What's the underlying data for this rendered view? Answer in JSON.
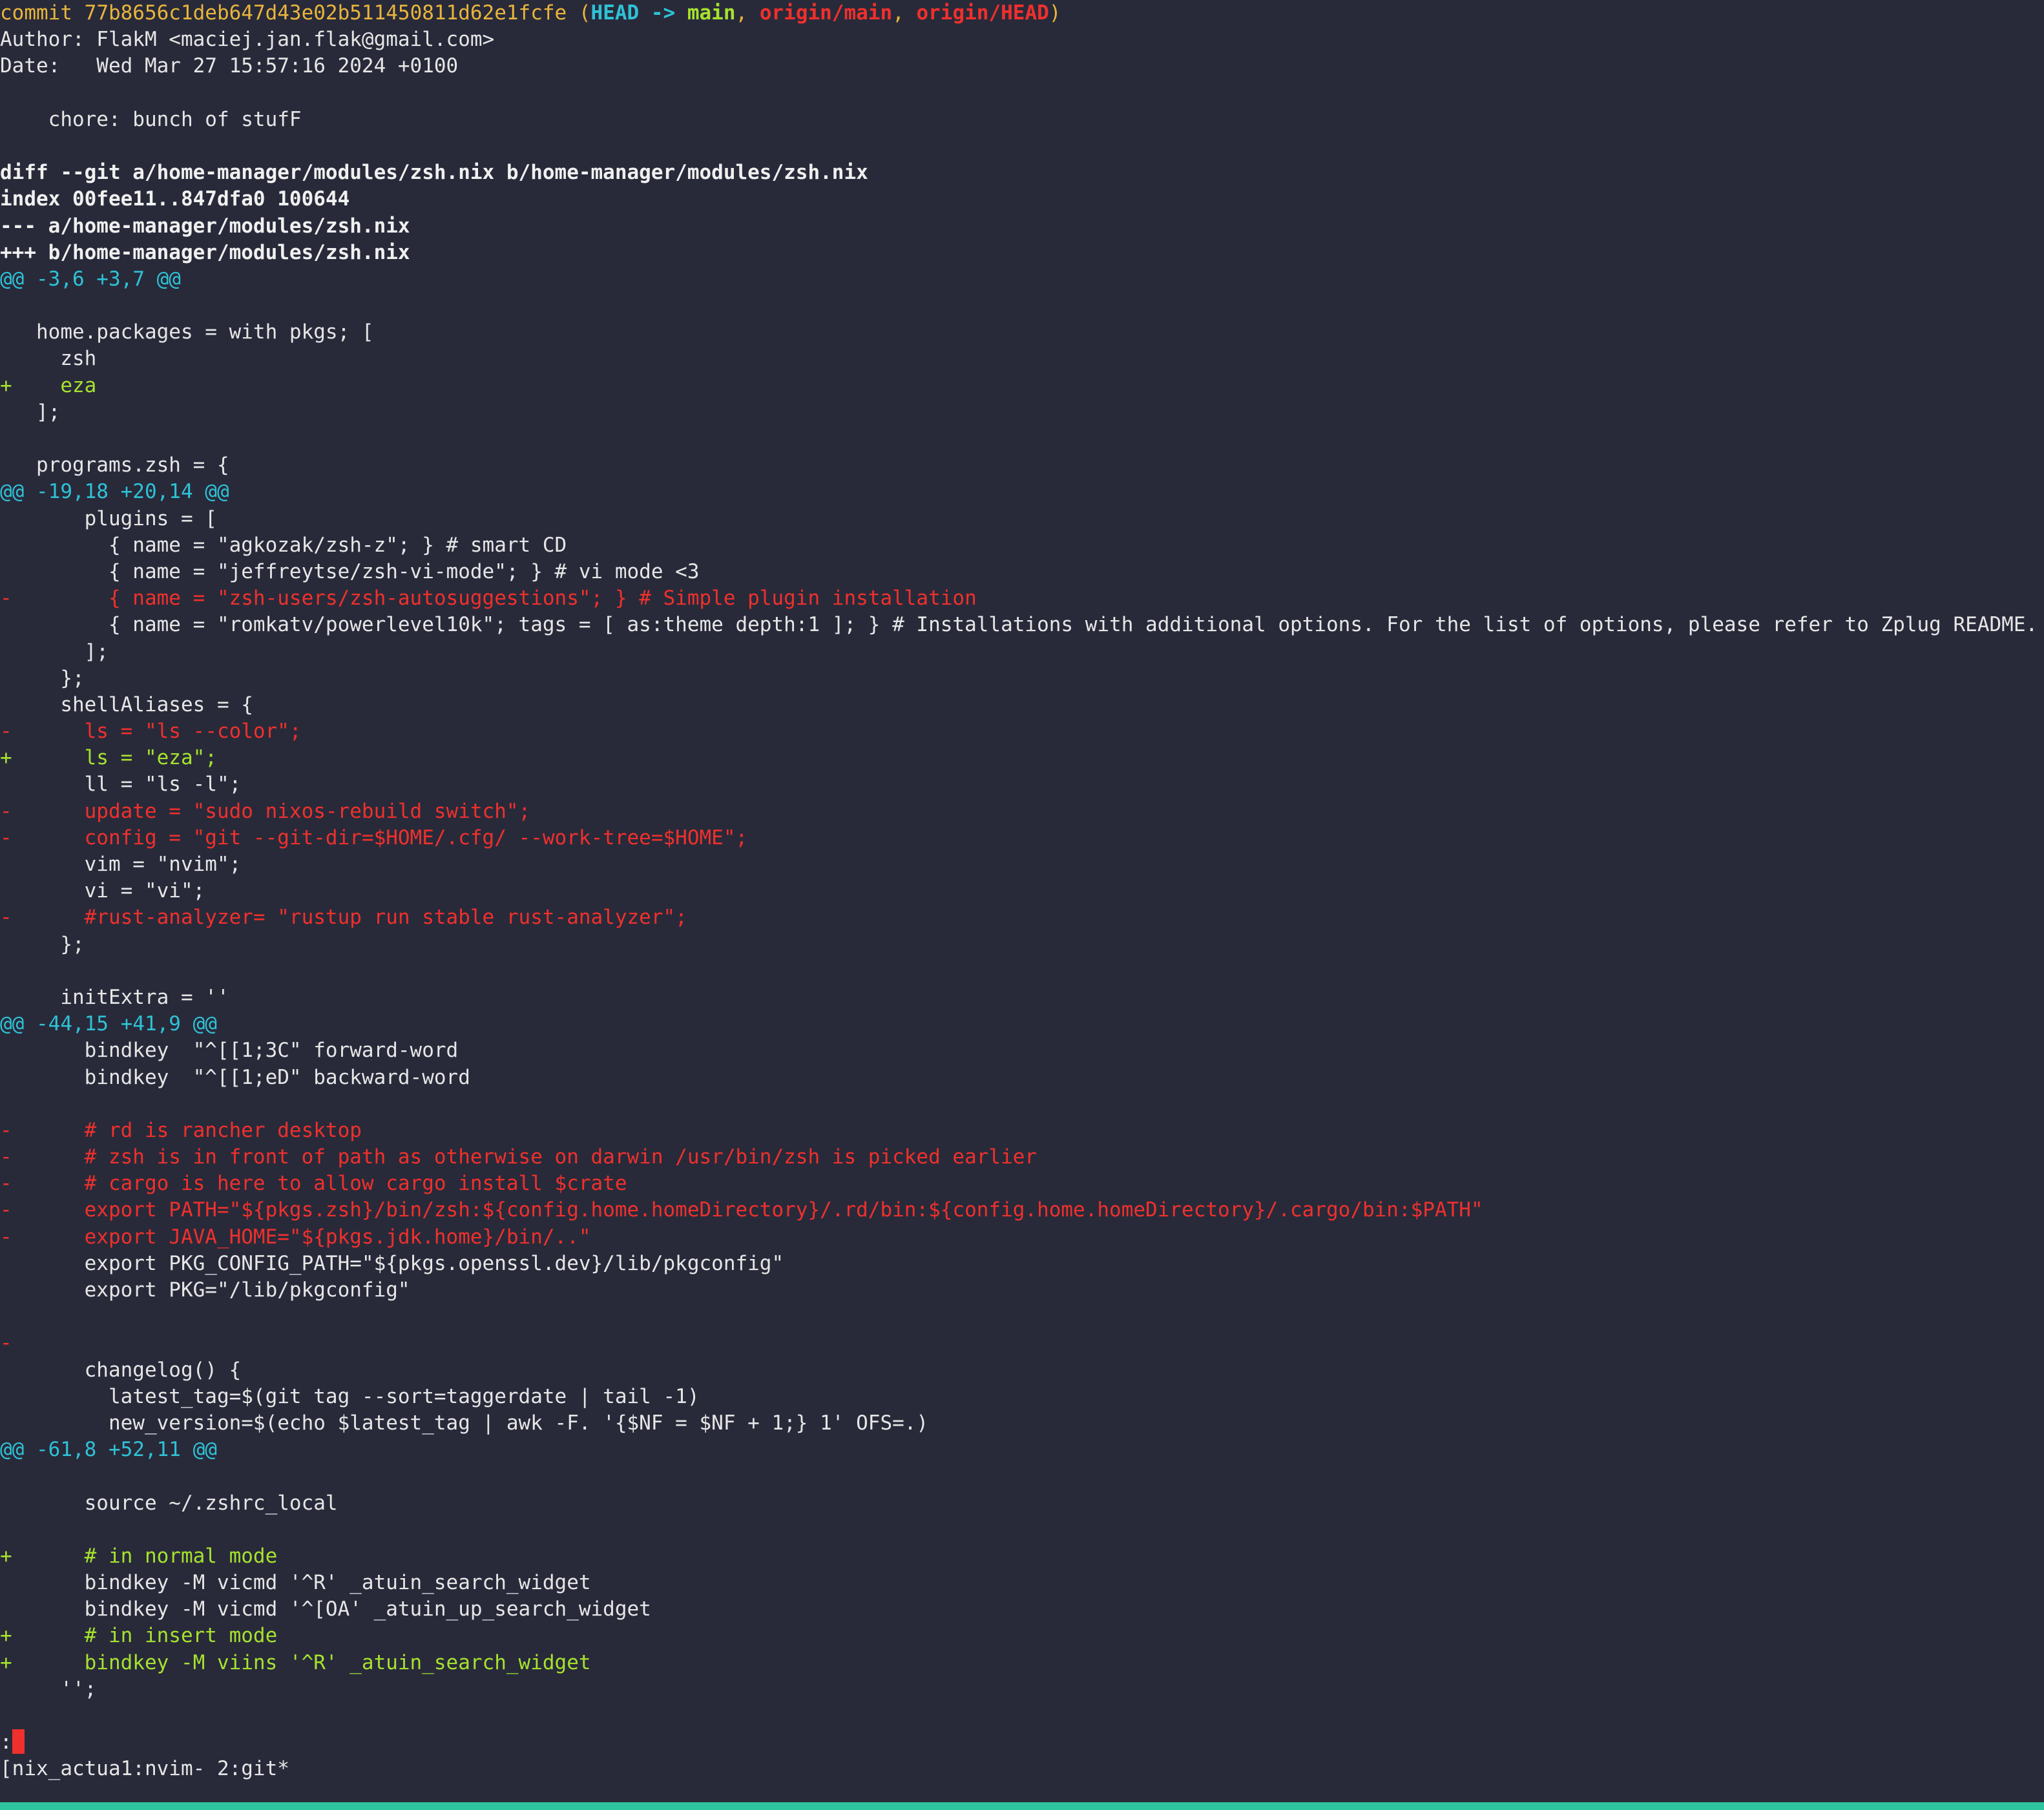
{
  "commit_header": {
    "prefix": "commit ",
    "hash": "77b8656c1deb647d43e02b511450811d62e1fcfe",
    "open": " (",
    "head": "HEAD -> ",
    "branch": "main",
    "sep1": ", ",
    "origin_main": "origin/main",
    "sep2": ", ",
    "origin_head": "origin/HEAD",
    "close": ")"
  },
  "lines": [
    {
      "type": "ctx",
      "text": "Author: FlakM <maciej.jan.flak@gmail.com>"
    },
    {
      "type": "ctx",
      "text": "Date:   Wed Mar 27 15:57:16 2024 +0100"
    },
    {
      "type": "ctx",
      "text": ""
    },
    {
      "type": "ctx",
      "text": "    chore: bunch of stufF"
    },
    {
      "type": "ctx",
      "text": ""
    },
    {
      "type": "meta",
      "text": "diff --git a/home-manager/modules/zsh.nix b/home-manager/modules/zsh.nix"
    },
    {
      "type": "meta",
      "text": "index 00fee11..847dfa0 100644"
    },
    {
      "type": "meta",
      "text": "--- a/home-manager/modules/zsh.nix"
    },
    {
      "type": "meta",
      "text": "+++ b/home-manager/modules/zsh.nix"
    },
    {
      "type": "hunk",
      "text": "@@ -3,6 +3,7 @@"
    },
    {
      "type": "ctx",
      "text": ""
    },
    {
      "type": "ctx",
      "text": "   home.packages = with pkgs; ["
    },
    {
      "type": "ctx",
      "text": "     zsh"
    },
    {
      "type": "add",
      "text": "+    eza"
    },
    {
      "type": "ctx",
      "text": "   ];"
    },
    {
      "type": "ctx",
      "text": ""
    },
    {
      "type": "ctx",
      "text": "   programs.zsh = {"
    },
    {
      "type": "hunk",
      "text": "@@ -19,18 +20,14 @@"
    },
    {
      "type": "ctx",
      "text": "       plugins = ["
    },
    {
      "type": "ctx",
      "text": "         { name = \"agkozak/zsh-z\"; } # smart CD"
    },
    {
      "type": "ctx",
      "text": "         { name = \"jeffreytse/zsh-vi-mode\"; } # vi mode <3"
    },
    {
      "type": "del",
      "text": "-        { name = \"zsh-users/zsh-autosuggestions\"; } # Simple plugin installation"
    },
    {
      "type": "ctx",
      "text": "         { name = \"romkatv/powerlevel10k\"; tags = [ as:theme depth:1 ]; } # Installations with additional options. For the list of options, please refer to Zplug README."
    },
    {
      "type": "ctx",
      "text": "       ];"
    },
    {
      "type": "ctx",
      "text": "     };"
    },
    {
      "type": "ctx",
      "text": "     shellAliases = {"
    },
    {
      "type": "del",
      "text": "-      ls = \"ls --color\";"
    },
    {
      "type": "add",
      "text": "+      ls = \"eza\";"
    },
    {
      "type": "ctx",
      "text": "       ll = \"ls -l\";"
    },
    {
      "type": "del",
      "text": "-      update = \"sudo nixos-rebuild switch\";"
    },
    {
      "type": "del",
      "text": "-      config = \"git --git-dir=$HOME/.cfg/ --work-tree=$HOME\";"
    },
    {
      "type": "ctx",
      "text": "       vim = \"nvim\";"
    },
    {
      "type": "ctx",
      "text": "       vi = \"vi\";"
    },
    {
      "type": "del",
      "text": "-      #rust-analyzer= \"rustup run stable rust-analyzer\";"
    },
    {
      "type": "ctx",
      "text": "     };"
    },
    {
      "type": "ctx",
      "text": ""
    },
    {
      "type": "ctx",
      "text": "     initExtra = ''"
    },
    {
      "type": "hunk",
      "text": "@@ -44,15 +41,9 @@"
    },
    {
      "type": "ctx",
      "text": "       bindkey  \"^[[1;3C\" forward-word"
    },
    {
      "type": "ctx",
      "text": "       bindkey  \"^[[1;eD\" backward-word"
    },
    {
      "type": "ctx",
      "text": ""
    },
    {
      "type": "del",
      "text": "-      # rd is rancher desktop"
    },
    {
      "type": "del",
      "text": "-      # zsh is in front of path as otherwise on darwin /usr/bin/zsh is picked earlier"
    },
    {
      "type": "del",
      "text": "-      # cargo is here to allow cargo install $crate"
    },
    {
      "type": "del",
      "text": "-      export PATH=\"${pkgs.zsh}/bin/zsh:${config.home.homeDirectory}/.rd/bin:${config.home.homeDirectory}/.cargo/bin:$PATH\""
    },
    {
      "type": "del",
      "text": "-      export JAVA_HOME=\"${pkgs.jdk.home}/bin/..\""
    },
    {
      "type": "ctx",
      "text": "       export PKG_CONFIG_PATH=\"${pkgs.openssl.dev}/lib/pkgconfig\""
    },
    {
      "type": "ctx",
      "text": "       export PKG=\"/lib/pkgconfig\""
    },
    {
      "type": "ctx",
      "text": ""
    },
    {
      "type": "del",
      "text": "-"
    },
    {
      "type": "ctx",
      "text": "       changelog() {"
    },
    {
      "type": "ctx",
      "text": "         latest_tag=$(git tag --sort=taggerdate | tail -1)"
    },
    {
      "type": "ctx",
      "text": "         new_version=$(echo $latest_tag | awk -F. '{$NF = $NF + 1;} 1' OFS=.)"
    },
    {
      "type": "hunk",
      "text": "@@ -61,8 +52,11 @@"
    },
    {
      "type": "ctx",
      "text": ""
    },
    {
      "type": "ctx",
      "text": "       source ~/.zshrc_local"
    },
    {
      "type": "ctx",
      "text": ""
    },
    {
      "type": "add",
      "text": "+      # in normal mode"
    },
    {
      "type": "ctx",
      "text": "       bindkey -M vicmd '^R' _atuin_search_widget"
    },
    {
      "type": "ctx",
      "text": "       bindkey -M vicmd '^[OA' _atuin_up_search_widget"
    },
    {
      "type": "add",
      "text": "+      # in insert mode"
    },
    {
      "type": "add",
      "text": "+      bindkey -M viins '^R' _atuin_search_widget"
    },
    {
      "type": "ctx",
      "text": "     '';"
    },
    {
      "type": "ctx",
      "text": ""
    }
  ],
  "pager_prompt": ":",
  "tmux_status": "[nix_actua1:nvim- 2:git*",
  "colors": {
    "background": "#282a3a",
    "cursor": "#f0302c",
    "status_bar": "#2ec4a0"
  }
}
